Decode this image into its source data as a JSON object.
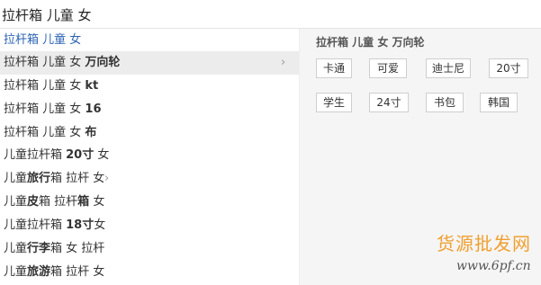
{
  "search": {
    "value": "拉杆箱 儿童 女"
  },
  "suggestions": [
    {
      "parts": [
        {
          "text": "拉杆箱 儿童 女",
          "bold": false
        }
      ]
    },
    {
      "parts": [
        {
          "text": "拉杆箱 儿童 女 ",
          "bold": false
        },
        {
          "text": "万向轮",
          "bold": true
        }
      ]
    },
    {
      "parts": [
        {
          "text": "拉杆箱 儿童 女 ",
          "bold": false
        },
        {
          "text": "kt",
          "bold": true
        }
      ]
    },
    {
      "parts": [
        {
          "text": "拉杆箱 儿童 女 ",
          "bold": false
        },
        {
          "text": "16",
          "bold": true
        }
      ]
    },
    {
      "parts": [
        {
          "text": "拉杆箱 儿童 女 ",
          "bold": false
        },
        {
          "text": "布",
          "bold": true
        }
      ]
    },
    {
      "parts": [
        {
          "text": "儿童拉杆箱 ",
          "bold": false
        },
        {
          "text": "20寸",
          "bold": true
        },
        {
          "text": " 女",
          "bold": false
        }
      ]
    },
    {
      "parts": [
        {
          "text": "儿童",
          "bold": false
        },
        {
          "text": "旅行",
          "bold": true
        },
        {
          "text": "箱 拉杆 女",
          "bold": false
        }
      ]
    },
    {
      "parts": [
        {
          "text": "儿童",
          "bold": false
        },
        {
          "text": "皮",
          "bold": true
        },
        {
          "text": "箱 拉杆",
          "bold": false
        },
        {
          "text": "箱",
          "bold": true
        },
        {
          "text": " 女",
          "bold": false
        }
      ]
    },
    {
      "parts": [
        {
          "text": "儿童拉杆箱 ",
          "bold": false
        },
        {
          "text": "18寸",
          "bold": true
        },
        {
          "text": "女",
          "bold": false
        }
      ]
    },
    {
      "parts": [
        {
          "text": "儿童",
          "bold": false
        },
        {
          "text": "行李",
          "bold": true
        },
        {
          "text": "箱 女 拉杆",
          "bold": false
        }
      ]
    },
    {
      "parts": [
        {
          "text": "儿童",
          "bold": false
        },
        {
          "text": "旅游",
          "bold": true
        },
        {
          "text": "箱 拉杆 女",
          "bold": false
        }
      ]
    }
  ],
  "right_panel": {
    "title": "拉杆箱 儿童 女 万向轮",
    "tags": [
      "卡通",
      "可爱",
      "迪士尼",
      "20寸",
      "学生",
      "24寸",
      "书包",
      "韩国"
    ]
  },
  "watermark": {
    "brand": "货源批发网",
    "url": "www.6pf.cn"
  },
  "icons": {
    "submenu_arrow": "chevron-right-icon"
  },
  "colors": {
    "first_suggestion": "#2d64b3",
    "active_row": "#ececec",
    "panel_bg": "#f5f5f5",
    "watermark": "#f0a030"
  }
}
